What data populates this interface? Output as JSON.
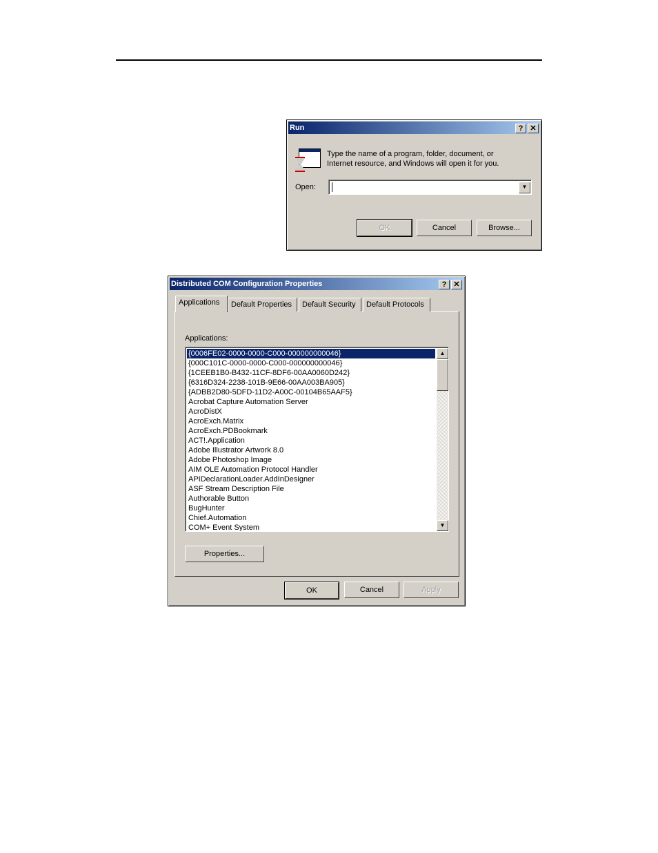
{
  "run": {
    "title": "Run",
    "help": "?",
    "close": "✕",
    "message_line1": "Type the name of a program, folder, document, or",
    "message_line2": "Internet resource, and Windows will open it for you.",
    "open_label": "Open:",
    "open_value": "",
    "ok": "OK",
    "cancel": "Cancel",
    "browse": "Browse..."
  },
  "dcom": {
    "title": "Distributed COM Configuration Properties",
    "help": "?",
    "close": "✕",
    "tabs": [
      "Applications",
      "Default Properties",
      "Default Security",
      "Default Protocols"
    ],
    "list_label": "Applications:",
    "items": [
      "{0006FE02-0000-0000-C000-000000000046}",
      "{000C101C-0000-0000-C000-000000000046}",
      "{1CEEB1B0-B432-11CF-8DF6-00AA0060D242}",
      "{6316D324-2238-101B-9E66-00AA003BA905}",
      "{ADBB2D80-5DFD-11D2-A00C-00104B65AAF5}",
      "Acrobat Capture Automation Server",
      "AcroDistX",
      "AcroExch.Matrix",
      "AcroExch.PDBookmark",
      "ACT!.Application",
      "Adobe Illustrator Artwork 8.0",
      "Adobe Photoshop Image",
      "AIM OLE Automation Protocol Handler",
      "APIDeclarationLoader.AddInDesigner",
      "ASF Stream Description File",
      "Authorable Button",
      "BugHunter",
      "Chief.Automation",
      "COM+ Event System"
    ],
    "selected_index": 0,
    "properties": "Properties...",
    "ok": "OK",
    "cancel": "Cancel",
    "apply": "Apply"
  }
}
